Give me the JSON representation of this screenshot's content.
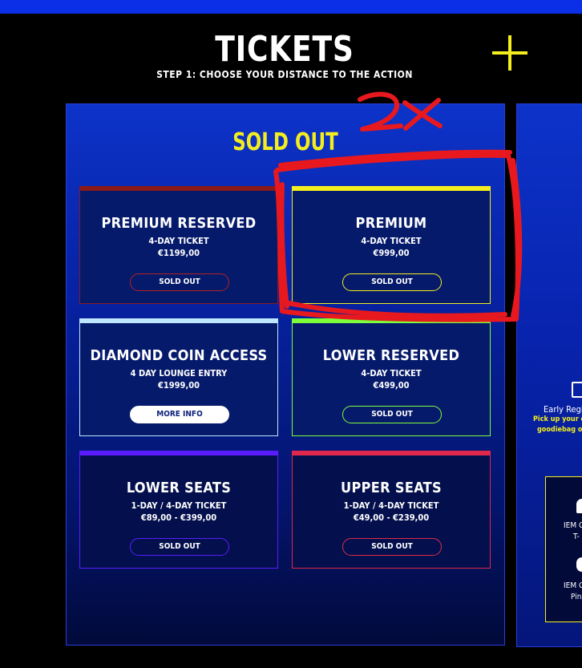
{
  "header": {
    "title": "TICKETS",
    "subtitle": "STEP 1: CHOOSE YOUR DISTANCE TO THE ACTION",
    "plus_icon": "plus-icon"
  },
  "panel": {
    "heading": "SOLD OUT",
    "cards": [
      {
        "name": "PREMIUM RESERVED",
        "sub": "4-DAY TICKET",
        "price": "€1199,00",
        "button": "SOLD OUT",
        "accent": "#8a1a1a"
      },
      {
        "name": "PREMIUM",
        "sub": "4-DAY TICKET",
        "price": "€999,00",
        "button": "SOLD OUT",
        "accent": "#f4ee1e"
      },
      {
        "name": "DIAMOND COIN ACCESS",
        "sub": "4 DAY LOUNGE ENTRY",
        "price": "€1999,00",
        "button": "MORE INFO",
        "accent": "#bfe6ff"
      },
      {
        "name": "LOWER RESERVED",
        "sub": "4-DAY TICKET",
        "price": "€499,00",
        "button": "SOLD OUT",
        "accent": "#7dff3a"
      },
      {
        "name": "LOWER SEATS",
        "sub": "1-DAY / 4-DAY TICKET",
        "price": "€89,00 - €399,00",
        "button": "SOLD OUT",
        "accent": "#5a1cff"
      },
      {
        "name": "UPPER SEATS",
        "sub": "1-DAY / 4-DAY TICKET",
        "price": "€49,00 - €239,00",
        "button": "SOLD OUT",
        "accent": "#e0284a"
      }
    ]
  },
  "side_panel": {
    "line1": "Early Regi",
    "line2": "Pick up your cr",
    "line3": "goodiebag on",
    "box_line1": "IEM C",
    "box_line2": "T-",
    "box_line3": "IEM C",
    "box_line4": "Pin"
  },
  "annotation": {
    "text": "2x",
    "color": "#e8191e"
  }
}
